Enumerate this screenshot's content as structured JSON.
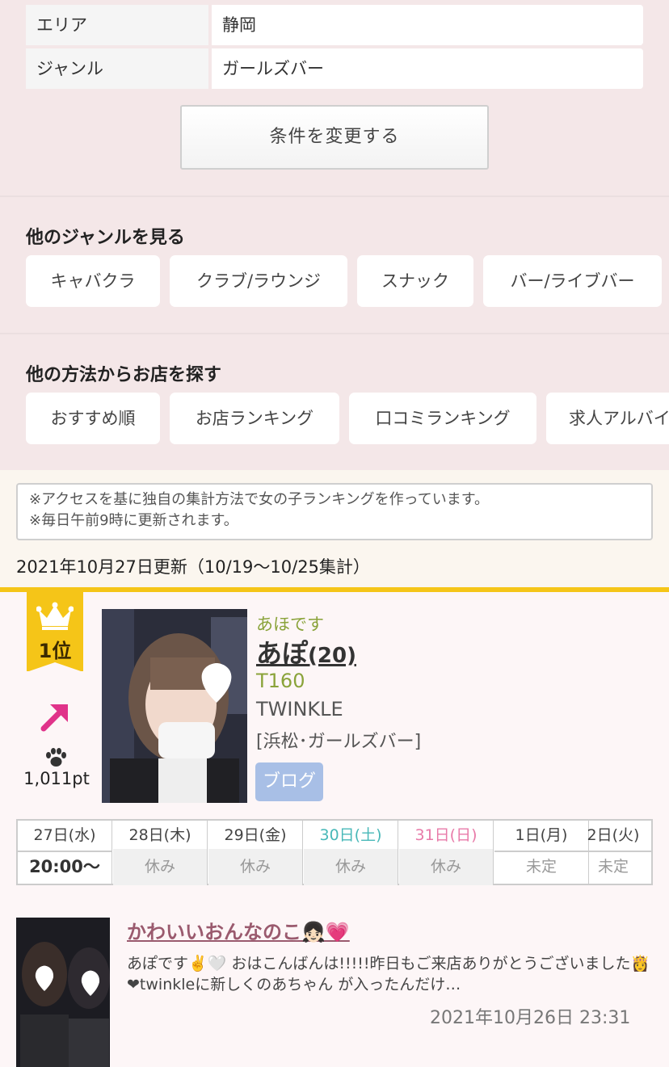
{
  "conditions": {
    "rows": [
      {
        "label": "エリア",
        "value": "静岡"
      },
      {
        "label": "ジャンル",
        "value": "ガールズバー"
      }
    ],
    "change_button": "条件を変更する"
  },
  "genres": {
    "title": "他のジャンルを見る",
    "items": [
      "キャバクラ",
      "クラブ/ラウンジ",
      "スナック",
      "バー/ライブバー"
    ]
  },
  "methods": {
    "title": "他の方法からお店を探す",
    "items": [
      "おすすめ順",
      "お店ランキング",
      "口コミランキング",
      "求人アルバイ"
    ]
  },
  "notice": {
    "line1": "※アクセスを基に独自の集計方法で女の子ランキングを作っています。",
    "line2": "※毎日午前9時に更新されます。",
    "updated": "2021年10月27日更新（10/19〜10/25集計）"
  },
  "ranking": {
    "rank_label": "1位",
    "points": "1,011pt",
    "reading": "あほです",
    "name": "あぽ",
    "age": "(20)",
    "height": "T160",
    "shop": "TWINKLE",
    "area_genre": "[浜松･ガールズバー]",
    "blog_button": "ブログ",
    "accent_color": "#f5c518",
    "arrow_color": "#e0338a"
  },
  "schedule": {
    "days": [
      {
        "date": "27日(水)",
        "status": "20:00〜",
        "type": "work",
        "weekday": "normal"
      },
      {
        "date": "28日(木)",
        "status": "休み",
        "type": "off",
        "weekday": "normal"
      },
      {
        "date": "29日(金)",
        "status": "休み",
        "type": "off",
        "weekday": "normal"
      },
      {
        "date": "30日(土)",
        "status": "休み",
        "type": "off",
        "weekday": "sat"
      },
      {
        "date": "31日(日)",
        "status": "休み",
        "type": "off",
        "weekday": "sun"
      },
      {
        "date": "1日(月)",
        "status": "未定",
        "type": "undecided",
        "weekday": "normal"
      },
      {
        "date": "2日(火)",
        "status": "未定",
        "type": "undecided",
        "weekday": "normal"
      }
    ]
  },
  "blog": {
    "title": "かわいいおんなのこ👧🏻💗",
    "body": "あぽです✌️🤍 おはこんばんは!!!!!昨日もご来店ありがとうございました👸 ❤twinkleに新しくのあちゃん が入ったんだけ…",
    "date": "2021年10月26日 23:31"
  }
}
